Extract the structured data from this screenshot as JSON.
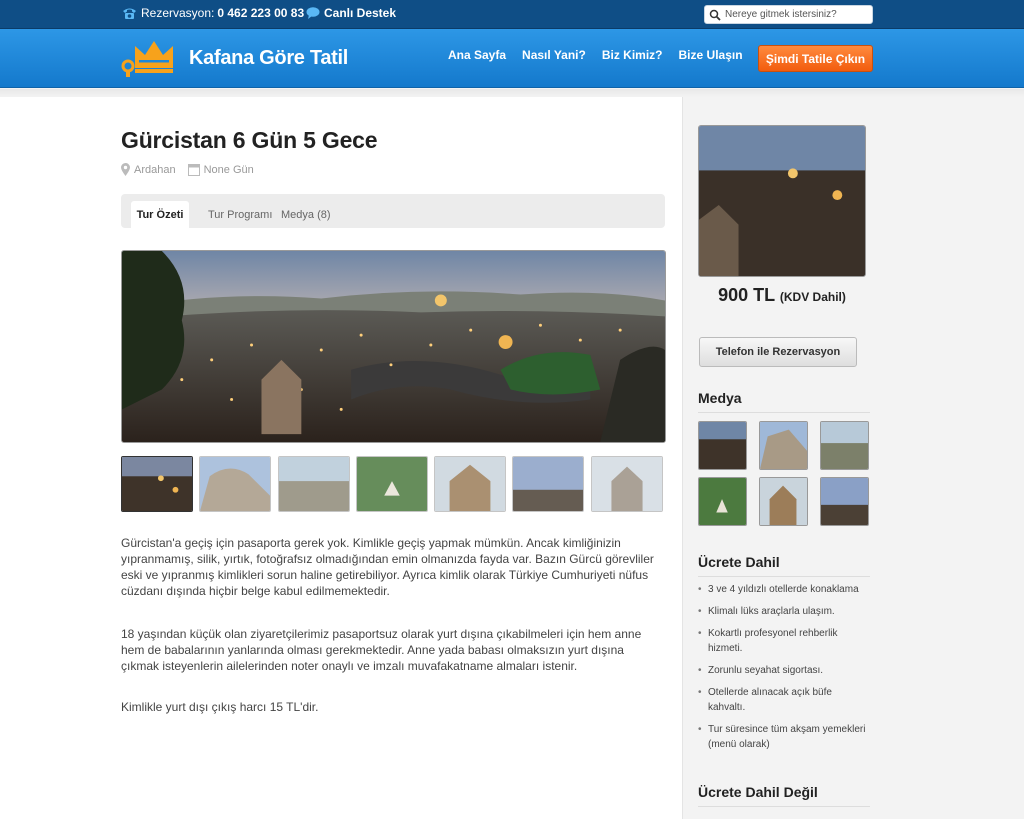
{
  "topbar": {
    "phone_label": "Rezervasyon:",
    "phone_number": "0 462 223 00 83",
    "support_label": "Canlı Destek",
    "search_placeholder": "Nereye gitmek istersiniz?"
  },
  "header": {
    "logo_text": "Kafana Göre Tatil",
    "nav": [
      "Ana Sayfa",
      "Nasıl Yani?",
      "Biz Kimiz?",
      "Bize Ulaşın"
    ],
    "cta_label": "Şimdi Tatile Çıkın"
  },
  "colors": {
    "topbar": "#0f4e86",
    "header": "#1f88d8",
    "cta": "#f4661a",
    "logo_crown": "#f7a21b"
  },
  "tour": {
    "title": "Gürcistan 6 Gün 5 Gece",
    "location": "Ardahan",
    "duration": "None Gün",
    "tabs": [
      "Tur Özeti",
      "Tur Programı",
      "Medya (8)"
    ],
    "active_tab": "Tur Özeti",
    "paragraphs": [
      "Gürcistan'a geçiş için pasaporta gerek yok. Kimlikle geçiş yapmak mümkün. Ancak kimliğinizin yıpranmamış, silik, yırtık, fotoğrafsız olmadığından emin olmanızda fayda var. Bazın Gürcü görevliler eski ve yıpranmış kimlikleri sorun haline getirebiliyor. Ayrıca kimlik olarak Türkiye Cumhuriyeti nüfus cüzdanı dışında hiçbir belge kabul edilmemektedir.",
      "18 yaşından küçük olan ziyaretçilerimiz pasaportsuz olarak yurt dışına çıkabilmeleri için hem anne hem de babalarının yanlarında olması gerekmektedir. Anne yada babası olmaksızın yurt dışına çıkmak isteyenlerin ailelerinden noter onaylı ve imzalı muvafakatname almaları istenir.",
      "Kimlikle yurt dışı çıkış harcı 15 TL'dir."
    ]
  },
  "sidebar": {
    "price": "900 TL",
    "price_note": "(KDV Dahil)",
    "reservation_button": "Telefon ile Rezervasyon",
    "media_heading": "Medya",
    "included_heading": "Ücrete Dahil",
    "included_items": [
      "3 ve 4 yıldızlı otellerde konaklama",
      "Klimalı lüks araçlarla ulaşım.",
      "Kokartlı profesyonel rehberlik hizmeti.",
      "Zorunlu seyahat sigortası.",
      "Otellerde alınacak açık büfe kahvaltı.",
      "Tur süresince tüm akşam yemekleri (menü olarak)"
    ],
    "not_included_heading": "Ücrete Dahil Değil"
  }
}
